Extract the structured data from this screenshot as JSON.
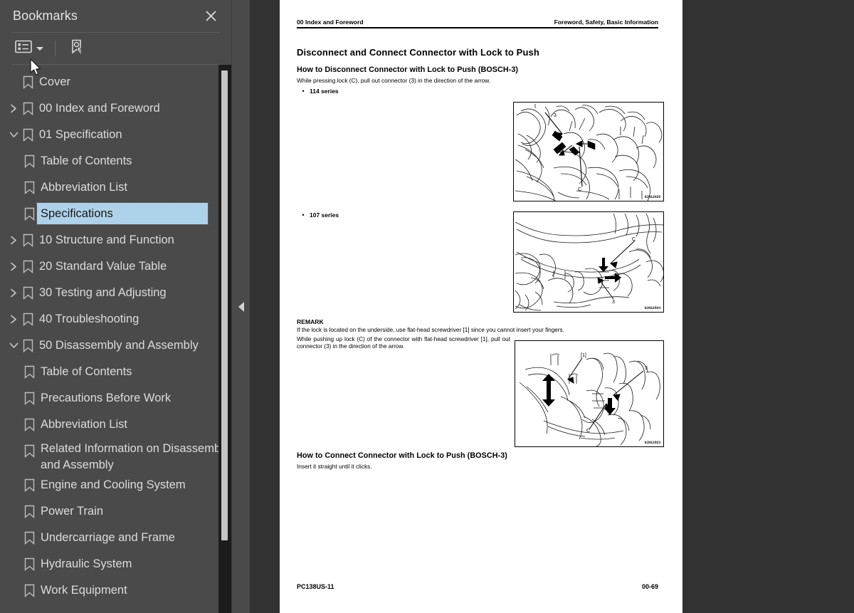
{
  "panel": {
    "title": "Bookmarks",
    "close_icon": "close-icon",
    "toolbar": {
      "options_icon": "bookmark-options-list-icon",
      "options_caret": "chevron-down-icon",
      "find_icon": "find-bookmark-icon"
    }
  },
  "tree": {
    "items": [
      {
        "label": "Cover",
        "level": 0,
        "twisty": "none",
        "selected": false
      },
      {
        "label": "00 Index and Foreword",
        "level": 0,
        "twisty": "collapsed",
        "selected": false
      },
      {
        "label": "01 Specification",
        "level": 0,
        "twisty": "expanded",
        "selected": false
      },
      {
        "label": "Table of Contents",
        "level": 1,
        "twisty": "none",
        "selected": false
      },
      {
        "label": "Abbreviation List",
        "level": 1,
        "twisty": "none",
        "selected": false
      },
      {
        "label": "Specifications",
        "level": 1,
        "twisty": "collapsed",
        "selected": true
      },
      {
        "label": "10 Structure and Function",
        "level": 0,
        "twisty": "collapsed",
        "selected": false
      },
      {
        "label": "20 Standard Value Table",
        "level": 0,
        "twisty": "collapsed",
        "selected": false
      },
      {
        "label": "30 Testing and Adjusting",
        "level": 0,
        "twisty": "collapsed",
        "selected": false
      },
      {
        "label": "40 Troubleshooting",
        "level": 0,
        "twisty": "collapsed",
        "selected": false
      },
      {
        "label": "50 Disassembly and Assembly",
        "level": 0,
        "twisty": "expanded",
        "selected": false
      },
      {
        "label": "Table of Contents",
        "level": 1,
        "twisty": "none",
        "selected": false
      },
      {
        "label": "Precautions Before Work",
        "level": 1,
        "twisty": "none",
        "selected": false
      },
      {
        "label": "Abbreviation List",
        "level": 1,
        "twisty": "none",
        "selected": false
      },
      {
        "label": "Related Information on Disassembly and Assembly",
        "level": 1,
        "twisty": "collapsed",
        "selected": false,
        "two_line": true
      },
      {
        "label": "Engine and Cooling System",
        "level": 1,
        "twisty": "collapsed",
        "selected": false
      },
      {
        "label": "Power Train",
        "level": 1,
        "twisty": "collapsed",
        "selected": false
      },
      {
        "label": "Undercarriage and Frame",
        "level": 1,
        "twisty": "collapsed",
        "selected": false
      },
      {
        "label": "Hydraulic System",
        "level": 1,
        "twisty": "collapsed",
        "selected": false
      },
      {
        "label": "Work Equipment",
        "level": 1,
        "twisty": "collapsed",
        "selected": false
      }
    ]
  },
  "splitter": {
    "collapse_icon": "collapse-panel-arrow-icon"
  },
  "document": {
    "header_left": "00 Index and Foreword",
    "header_right": "Foreword, Safety, Basic Information",
    "title": "Disconnect and Connect Connector with Lock to Push",
    "section1_heading": "How to Disconnect Connector with Lock to Push (BOSCH-3)",
    "section1_intro": "While pressing lock (C), pull out connector (3) in the direction of the arrow.",
    "bullets": [
      {
        "text": "114 series"
      },
      {
        "text": "107 series"
      }
    ],
    "remark_title": "REMARK",
    "remark_lines": [
      "If the lock is located on the underside, use flat-head screwdriver [1] since you cannot insert your fingers.",
      "While pushing up lock (C) of the connector with flat-head screwdriver [1], pull out connector (3) in the direction of the arrow."
    ],
    "section2_heading": "How to Connect Connector with Lock to Push (BOSCH-3)",
    "section2_body": "Insert it straight until it clicks.",
    "footer_left": "PC138US-11",
    "footer_right": "00-69",
    "figures": [
      {
        "code": "HJH12925",
        "caption_ref": "114 series"
      },
      {
        "code": "HJH12924",
        "caption_ref": "107 series"
      },
      {
        "code": "HJH12923",
        "caption_ref": "remark"
      }
    ]
  },
  "colors": {
    "panel_bg": "#4a4a4a",
    "viewer_bg": "#323232",
    "selection": "#aed2e9",
    "page_bg": "#ffffff",
    "text": "#dcdcdc"
  }
}
